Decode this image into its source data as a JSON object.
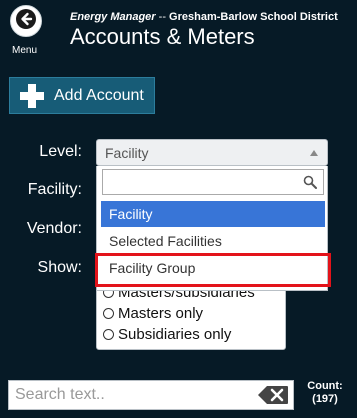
{
  "header": {
    "menu_label": "Menu",
    "app_name": "Energy Manager",
    "separator": "--",
    "district": "Gresham-Barlow School District",
    "page_title": "Accounts & Meters"
  },
  "toolbar": {
    "add_account_label": "Add Account"
  },
  "filters": {
    "level_label": "Level:",
    "facility_label": "Facility:",
    "vendor_label": "Vendor:",
    "show_label": "Show:",
    "level_value": "Facility",
    "level_options": [
      "Facility",
      "Selected Facilities",
      "Facility Group"
    ],
    "show_options": [
      "Masters/subsidiaries",
      "Masters only",
      "Subsidiaries only"
    ]
  },
  "search": {
    "placeholder": "Search text.."
  },
  "count": {
    "label": "Count:",
    "value": "(197)"
  },
  "colors": {
    "background": "#061a26",
    "add_button": "#175c77",
    "selected_option": "#3875d7",
    "highlight_border": "#e3131a"
  }
}
